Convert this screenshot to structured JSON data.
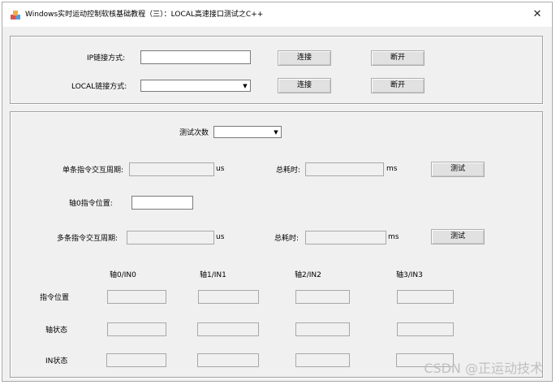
{
  "window": {
    "title": "Windows实时运动控制软核基础教程（三）：LOCAL高速接口测试之C++",
    "close_glyph": "✕"
  },
  "connection": {
    "ip_label": "IP链接方式:",
    "ip_value": "",
    "ip_connect": "连接",
    "ip_disconnect": "断开",
    "local_label": "LOCAL链接方式:",
    "local_value": "",
    "local_connect": "连接",
    "local_disconnect": "断开"
  },
  "test": {
    "count_label": "测试次数",
    "count_value": "",
    "single_cycle_label": "单条指令交互周期:",
    "single_cycle_value": "",
    "single_cycle_unit": "us",
    "single_total_label": "总耗时:",
    "single_total_value": "",
    "single_total_unit": "ms",
    "single_test_button": "测试",
    "axis0_pos_label": "轴0指令位置:",
    "axis0_pos_value": "",
    "multi_cycle_label": "多条指令交互周期:",
    "multi_cycle_value": "",
    "multi_cycle_unit": "us",
    "multi_total_label": "总耗时:",
    "multi_total_value": "",
    "multi_total_unit": "ms",
    "multi_test_button": "测试"
  },
  "axes": {
    "columns": [
      "轴0/IN0",
      "轴1/IN1",
      "轴2/IN2",
      "轴3/IN3"
    ],
    "rows": [
      "指令位置",
      "轴状态",
      "IN状态"
    ]
  },
  "watermark": "CSDN @正运动技术"
}
